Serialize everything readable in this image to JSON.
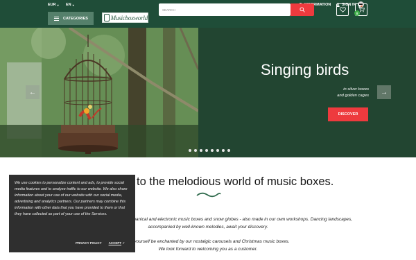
{
  "topbar": {
    "currency": "EUR",
    "language": "EN",
    "information": "INFORMATION",
    "signin": "SIGN IN"
  },
  "header": {
    "categories": "CATEGORIES",
    "logo_text": "Musicboxworld",
    "search_placeholder": "SEARCH",
    "cart_count": "0"
  },
  "hero": {
    "title": "Singing birds",
    "subtitle_line1": "in silver boxes",
    "subtitle_line2": "and golden cages",
    "cta": "DISCOVER",
    "slide_count": 8
  },
  "main": {
    "welcome": "Welcome to the melodious world of music boxes.",
    "intro_line1": "Discover our wide selection of mechanical and electronic music boxes and snow globes - also made in our own workshops. Dancing landscapes,",
    "intro_line2": "accompanied by well-known melodies, await your discovery.",
    "intro_line3": "Let yourself be enchanted by our nostalgic carousels and Christmas music boxes.",
    "intro_line4": "We look forward to welcoming you as a customer."
  },
  "cookie": {
    "text": "We use cookies to personalize content and ads, to provide social media features and to analyze traffic to our website. We also share information about your use of our website with our social media, advertising and analytics partners. Our partners may combine this information with other data that you have provided to them or that they have collected as part of your use of the Services.",
    "privacy": "PRIVACY POLICY",
    "accept": "ACCEPT"
  },
  "colors": {
    "brand_green": "#1f4d38",
    "accent_red": "#ee3a3e",
    "cart_badge": "#3fae49"
  }
}
